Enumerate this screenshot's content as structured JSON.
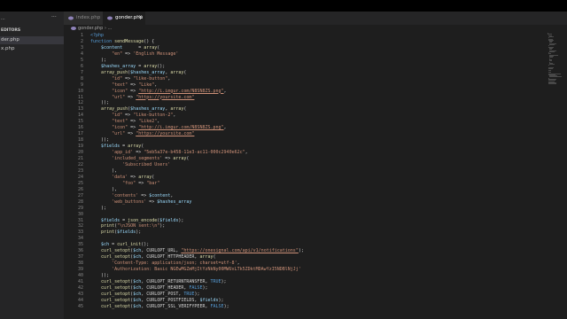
{
  "colors": {
    "accent": "#1e1e1e",
    "php_icon": "#8e82b8",
    "keyword": "#569cd6",
    "string": "#ce9178",
    "variable": "#9cdcfe",
    "function": "#dcdcaa",
    "text": "#d4d4d4",
    "line_number": "#858585"
  },
  "sidebar": {
    "header_text": "...",
    "header_dots": "···",
    "section_label": "EDITORS",
    "files": [
      {
        "label": "der.php",
        "active": true
      },
      {
        "label": "x.php",
        "active": false
      }
    ]
  },
  "tabs": [
    {
      "label": "index.php",
      "active": false,
      "icon": "php-icon"
    },
    {
      "label": "gonder.php",
      "active": true,
      "icon": "php-icon",
      "close": "✕"
    }
  ],
  "breadcrumb": {
    "file": "gonder.php",
    "path": "..."
  },
  "code_lines": [
    {
      "n": "1",
      "tokens": [
        [
          "kw",
          "<?php"
        ]
      ]
    },
    {
      "n": "2",
      "tokens": [
        [
          "kw",
          "function "
        ],
        [
          "fn",
          "sendMessage"
        ],
        [
          "punc",
          "() {"
        ]
      ]
    },
    {
      "n": "3",
      "tokens": [
        [
          "punc",
          "    "
        ],
        [
          "var",
          "$content"
        ],
        [
          "punc",
          "      = "
        ],
        [
          "fn",
          "array"
        ],
        [
          "punc",
          "("
        ]
      ]
    },
    {
      "n": "4",
      "tokens": [
        [
          "punc",
          "        "
        ],
        [
          "str",
          "\"en\""
        ],
        [
          "punc",
          " => "
        ],
        [
          "str",
          "'English Message'"
        ]
      ]
    },
    {
      "n": "5",
      "tokens": [
        [
          "punc",
          "    );"
        ]
      ]
    },
    {
      "n": "6",
      "tokens": [
        [
          "punc",
          "    "
        ],
        [
          "var",
          "$hashes_array"
        ],
        [
          "punc",
          " = "
        ],
        [
          "fn",
          "array"
        ],
        [
          "punc",
          "();"
        ]
      ]
    },
    {
      "n": "7",
      "tokens": [
        [
          "punc",
          "    "
        ],
        [
          "fn",
          "array_push"
        ],
        [
          "punc",
          "("
        ],
        [
          "var",
          "$hashes_array"
        ],
        [
          "punc",
          ", "
        ],
        [
          "fn",
          "array"
        ],
        [
          "punc",
          "("
        ]
      ]
    },
    {
      "n": "8",
      "tokens": [
        [
          "punc",
          "        "
        ],
        [
          "str",
          "\"id\""
        ],
        [
          "punc",
          " => "
        ],
        [
          "str",
          "\"like-button\""
        ],
        [
          "punc",
          ","
        ]
      ]
    },
    {
      "n": "9",
      "tokens": [
        [
          "punc",
          "        "
        ],
        [
          "str",
          "\"text\""
        ],
        [
          "punc",
          " => "
        ],
        [
          "str",
          "\"Like\""
        ],
        [
          "punc",
          ","
        ]
      ]
    },
    {
      "n": "10",
      "tokens": [
        [
          "punc",
          "        "
        ],
        [
          "str",
          "\"icon\""
        ],
        [
          "punc",
          " => "
        ],
        [
          "url",
          "\"http://i.imgur.com/N8SN8ZS.png\""
        ],
        [
          "punc",
          ","
        ]
      ]
    },
    {
      "n": "11",
      "tokens": [
        [
          "punc",
          "        "
        ],
        [
          "str",
          "\"url\""
        ],
        [
          "punc",
          " => "
        ],
        [
          "url",
          "\"https://yoursite.com\""
        ]
      ]
    },
    {
      "n": "12",
      "tokens": [
        [
          "punc",
          "    ));"
        ]
      ]
    },
    {
      "n": "13",
      "tokens": [
        [
          "punc",
          "    "
        ],
        [
          "fn",
          "array_push"
        ],
        [
          "punc",
          "("
        ],
        [
          "var",
          "$hashes_array"
        ],
        [
          "punc",
          ", "
        ],
        [
          "fn",
          "array"
        ],
        [
          "punc",
          "("
        ]
      ]
    },
    {
      "n": "14",
      "tokens": [
        [
          "punc",
          "        "
        ],
        [
          "str",
          "\"id\""
        ],
        [
          "punc",
          " => "
        ],
        [
          "str",
          "\"like-button-2\""
        ],
        [
          "punc",
          ","
        ]
      ]
    },
    {
      "n": "15",
      "tokens": [
        [
          "punc",
          "        "
        ],
        [
          "str",
          "\"text\""
        ],
        [
          "punc",
          " => "
        ],
        [
          "str",
          "\"Like2\""
        ],
        [
          "punc",
          ","
        ]
      ]
    },
    {
      "n": "16",
      "tokens": [
        [
          "punc",
          "        "
        ],
        [
          "str",
          "\"icon\""
        ],
        [
          "punc",
          " => "
        ],
        [
          "url",
          "\"http://i.imgur.com/N8SN8ZS.png\""
        ],
        [
          "punc",
          ","
        ]
      ]
    },
    {
      "n": "17",
      "tokens": [
        [
          "punc",
          "        "
        ],
        [
          "str",
          "\"url\""
        ],
        [
          "punc",
          " => "
        ],
        [
          "url",
          "\"https://yoursite.com\""
        ]
      ]
    },
    {
      "n": "18",
      "tokens": [
        [
          "punc",
          "    ));"
        ]
      ]
    },
    {
      "n": "19",
      "tokens": [
        [
          "punc",
          "    "
        ],
        [
          "var",
          "$fields"
        ],
        [
          "punc",
          " = "
        ],
        [
          "fn",
          "array"
        ],
        [
          "punc",
          "("
        ]
      ]
    },
    {
      "n": "20",
      "tokens": [
        [
          "punc",
          "        "
        ],
        [
          "str",
          "'app_id'"
        ],
        [
          "punc",
          " => "
        ],
        [
          "str",
          "\"5eb5a37e-b458-11e3-ac11-000c2940e62c\""
        ],
        [
          "punc",
          ","
        ]
      ]
    },
    {
      "n": "21",
      "tokens": [
        [
          "punc",
          "        "
        ],
        [
          "str",
          "'included_segments'"
        ],
        [
          "punc",
          " => "
        ],
        [
          "fn",
          "array"
        ],
        [
          "punc",
          "("
        ]
      ]
    },
    {
      "n": "22",
      "tokens": [
        [
          "punc",
          "            "
        ],
        [
          "str",
          "'Subscribed Users'"
        ]
      ]
    },
    {
      "n": "23",
      "tokens": [
        [
          "punc",
          "        ),"
        ]
      ]
    },
    {
      "n": "24",
      "tokens": [
        [
          "punc",
          "        "
        ],
        [
          "str",
          "'data'"
        ],
        [
          "punc",
          " => "
        ],
        [
          "fn",
          "array"
        ],
        [
          "punc",
          "("
        ]
      ]
    },
    {
      "n": "25",
      "tokens": [
        [
          "punc",
          "            "
        ],
        [
          "str",
          "\"foo\""
        ],
        [
          "punc",
          " => "
        ],
        [
          "str",
          "\"bar\""
        ]
      ]
    },
    {
      "n": "26",
      "tokens": [
        [
          "punc",
          "        ),"
        ]
      ]
    },
    {
      "n": "27",
      "tokens": [
        [
          "punc",
          "        "
        ],
        [
          "str",
          "'contents'"
        ],
        [
          "punc",
          " => "
        ],
        [
          "var",
          "$content"
        ],
        [
          "punc",
          ","
        ]
      ]
    },
    {
      "n": "28",
      "tokens": [
        [
          "punc",
          "        "
        ],
        [
          "str",
          "'web_buttons'"
        ],
        [
          "punc",
          " => "
        ],
        [
          "var",
          "$hashes_array"
        ]
      ]
    },
    {
      "n": "29",
      "tokens": [
        [
          "punc",
          "    );"
        ]
      ]
    },
    {
      "n": "30",
      "tokens": []
    },
    {
      "n": "31",
      "tokens": [
        [
          "punc",
          "    "
        ],
        [
          "var",
          "$fields"
        ],
        [
          "punc",
          " = "
        ],
        [
          "fn",
          "json_encode"
        ],
        [
          "punc",
          "("
        ],
        [
          "var",
          "$fields"
        ],
        [
          "punc",
          ");"
        ]
      ]
    },
    {
      "n": "32",
      "tokens": [
        [
          "punc",
          "    "
        ],
        [
          "fn",
          "print"
        ],
        [
          "punc",
          "("
        ],
        [
          "str",
          "\"\\nJSON sent:\\n\""
        ],
        [
          "punc",
          ");"
        ]
      ]
    },
    {
      "n": "33",
      "tokens": [
        [
          "punc",
          "    "
        ],
        [
          "fn",
          "print"
        ],
        [
          "punc",
          "("
        ],
        [
          "var",
          "$fields"
        ],
        [
          "punc",
          ");"
        ]
      ]
    },
    {
      "n": "34",
      "tokens": []
    },
    {
      "n": "35",
      "tokens": [
        [
          "punc",
          "    "
        ],
        [
          "var",
          "$ch"
        ],
        [
          "punc",
          " = "
        ],
        [
          "fn",
          "curl_init"
        ],
        [
          "punc",
          "();"
        ]
      ]
    },
    {
      "n": "36",
      "tokens": [
        [
          "punc",
          "    "
        ],
        [
          "fn",
          "curl_setopt"
        ],
        [
          "punc",
          "("
        ],
        [
          "var",
          "$ch"
        ],
        [
          "punc",
          ", CURLOPT_URL, "
        ],
        [
          "url",
          "\"https://onesignal.com/api/v1/notifications\""
        ],
        [
          "punc",
          ");"
        ]
      ]
    },
    {
      "n": "37",
      "tokens": [
        [
          "punc",
          "    "
        ],
        [
          "fn",
          "curl_setopt"
        ],
        [
          "punc",
          "("
        ],
        [
          "var",
          "$ch"
        ],
        [
          "punc",
          ", CURLOPT_HTTPHEADER, "
        ],
        [
          "fn",
          "array"
        ],
        [
          "punc",
          "("
        ]
      ]
    },
    {
      "n": "38",
      "tokens": [
        [
          "punc",
          "        "
        ],
        [
          "str",
          "'Content-Type: application/json; charset=utf-8'"
        ],
        [
          "punc",
          ","
        ]
      ]
    },
    {
      "n": "39",
      "tokens": [
        [
          "punc",
          "        "
        ],
        [
          "str",
          "'Authorization: Basic NGEwMGZmMjItYzNkNy00MWUxLTk5ZDktMDAwYzI5NDBlNjJj'"
        ]
      ]
    },
    {
      "n": "40",
      "tokens": [
        [
          "punc",
          "    ));"
        ]
      ]
    },
    {
      "n": "41",
      "tokens": [
        [
          "punc",
          "    "
        ],
        [
          "fn",
          "curl_setopt"
        ],
        [
          "punc",
          "("
        ],
        [
          "var",
          "$ch"
        ],
        [
          "punc",
          ", CURLOPT_RETURNTRANSFER, "
        ],
        [
          "kw",
          "TRUE"
        ],
        [
          "punc",
          ");"
        ]
      ]
    },
    {
      "n": "42",
      "tokens": [
        [
          "punc",
          "    "
        ],
        [
          "fn",
          "curl_setopt"
        ],
        [
          "punc",
          "("
        ],
        [
          "var",
          "$ch"
        ],
        [
          "punc",
          ", CURLOPT_HEADER, "
        ],
        [
          "kw",
          "FALSE"
        ],
        [
          "punc",
          ");"
        ]
      ]
    },
    {
      "n": "43",
      "tokens": [
        [
          "punc",
          "    "
        ],
        [
          "fn",
          "curl_setopt"
        ],
        [
          "punc",
          "("
        ],
        [
          "var",
          "$ch"
        ],
        [
          "punc",
          ", CURLOPT_POST, "
        ],
        [
          "kw",
          "TRUE"
        ],
        [
          "punc",
          ");"
        ]
      ]
    },
    {
      "n": "44",
      "tokens": [
        [
          "punc",
          "    "
        ],
        [
          "fn",
          "curl_setopt"
        ],
        [
          "punc",
          "("
        ],
        [
          "var",
          "$ch"
        ],
        [
          "punc",
          ", CURLOPT_POSTFIELDS, "
        ],
        [
          "var",
          "$fields"
        ],
        [
          "punc",
          ");"
        ]
      ]
    },
    {
      "n": "45",
      "tokens": [
        [
          "punc",
          "    "
        ],
        [
          "fn",
          "curl_setopt"
        ],
        [
          "punc",
          "("
        ],
        [
          "var",
          "$ch"
        ],
        [
          "punc",
          ", CURLOPT_SSL_VERIFYPEER, "
        ],
        [
          "kw",
          "FALSE"
        ],
        [
          "punc",
          ");"
        ]
      ]
    }
  ]
}
